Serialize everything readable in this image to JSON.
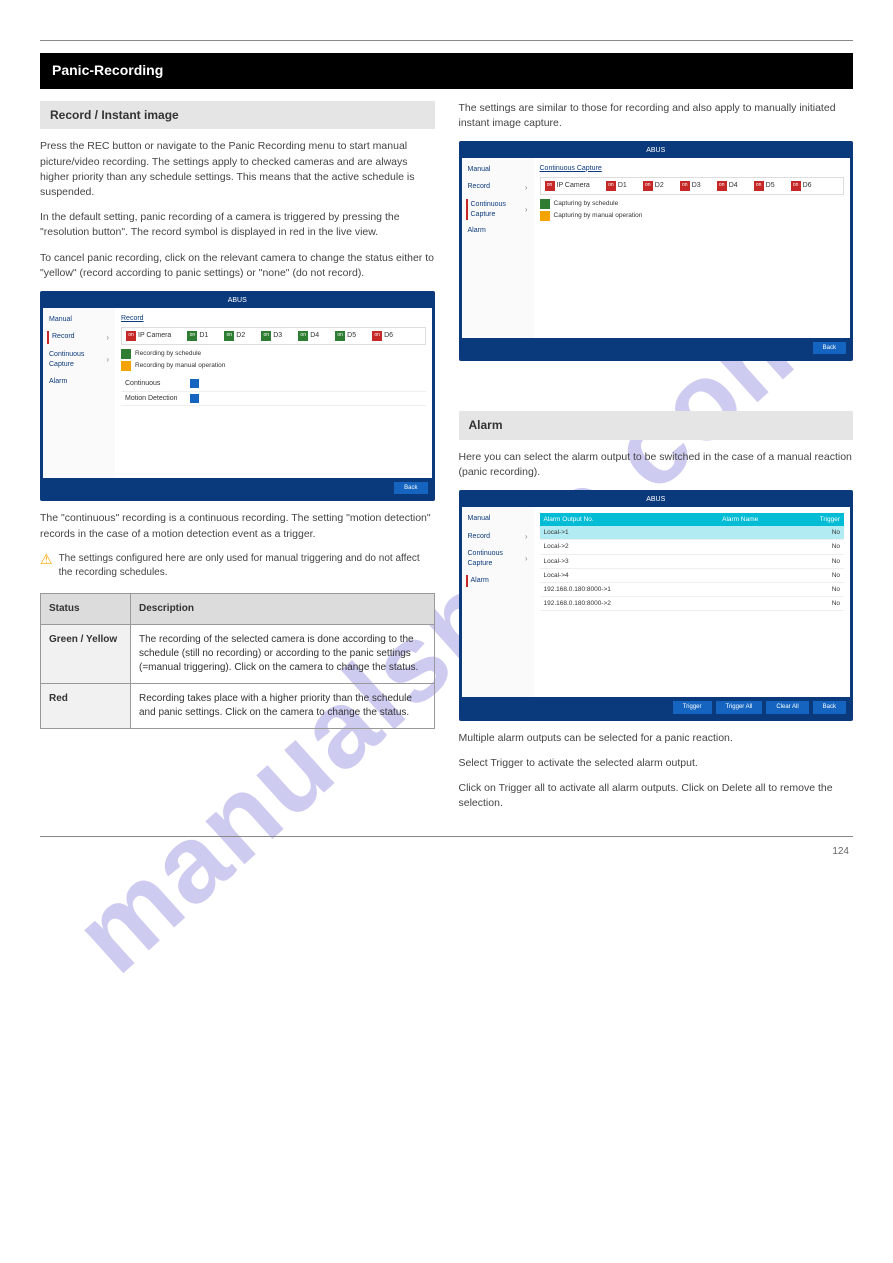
{
  "watermark": "manualshive.com",
  "page_number": "124",
  "black_bar_title": "Panic-Recording",
  "left": {
    "section_title": "Record / Instant image",
    "p1": "Press the REC button or navigate to the Panic Recording menu to start manual picture/video recording. The settings apply to checked cameras and are always higher priority than any schedule settings. This means that the active schedule is suspended.",
    "p2": "In the default setting, panic recording of a camera is triggered by pressing the \"resolution button\". The record symbol is displayed in red in the live view.",
    "p3": "To cancel panic recording, click on the relevant camera to change the status either to \"yellow\" (record according to panic settings) or \"none\" (do not record).",
    "p4": "The \"continuous\" recording is a continuous recording. The setting \"motion detection\" records in the case of a motion detection event as a trigger.",
    "warning": "The settings configured here are only used for manual triggering and do not affect the recording schedules.",
    "opt_table": {
      "h1": "Status",
      "h2": "Description",
      "rows": [
        {
          "label": "Green / Yellow",
          "desc": "The recording of the selected camera is done according to the schedule (still no recording) or according to the panic settings (=manual triggering). Click on the camera to change the status."
        },
        {
          "label": "Red",
          "desc": "Recording takes place with a higher priority than the schedule and panic settings. Click on the camera to change the status."
        }
      ]
    },
    "screenshot": {
      "logo": "ABUS",
      "sidebar": [
        "Manual",
        "Record",
        "Continuous Capture",
        "Alarm"
      ],
      "active": "Record",
      "main_title": "Record",
      "cam_header": "IP Camera",
      "cameras": [
        {
          "label": "D1",
          "state": "green"
        },
        {
          "label": "D2",
          "state": "green"
        },
        {
          "label": "D3",
          "state": "green"
        },
        {
          "label": "D4",
          "state": "green"
        },
        {
          "label": "D5",
          "state": "green"
        },
        {
          "label": "D6",
          "state": "red"
        }
      ],
      "legend": [
        {
          "color": "green",
          "text": "Recording by schedule"
        },
        {
          "color": "yellow",
          "text": "Recording by manual operation"
        }
      ],
      "rows": [
        {
          "label": "Continuous",
          "checked": true
        },
        {
          "label": "Motion Detection",
          "checked": true
        }
      ],
      "back_btn": "Back"
    }
  },
  "right": {
    "cc_p1": "The settings are similar to those for recording and also apply to manually initiated instant image capture.",
    "cc_screenshot": {
      "logo": "ABUS",
      "sidebar": [
        "Manual",
        "Record",
        "Continuous Capture",
        "Alarm"
      ],
      "active": "Continuous Capture",
      "main_title": "Continuous Capture",
      "cam_header": "IP Camera",
      "cameras": [
        {
          "label": "D1",
          "state": "red"
        },
        {
          "label": "D2",
          "state": "red"
        },
        {
          "label": "D3",
          "state": "red"
        },
        {
          "label": "D4",
          "state": "red"
        },
        {
          "label": "D5",
          "state": "red"
        },
        {
          "label": "D6",
          "state": "red"
        }
      ],
      "legend": [
        {
          "color": "green",
          "text": "Capturing by schedule"
        },
        {
          "color": "yellow",
          "text": "Capturing by manual operation"
        }
      ],
      "back_btn": "Back"
    },
    "alarm_title": "Alarm",
    "alarm_p1": "Here you can select the alarm output to be switched in the case of a manual reaction (panic recording).",
    "alarm_p2": "Multiple alarm outputs can be selected for a panic reaction.",
    "alarm_p3": "Select Trigger to activate the selected alarm output.",
    "alarm_p4": "Click on Trigger all to activate all alarm outputs. Click on Delete all to remove the selection.",
    "alarm_screenshot": {
      "logo": "ABUS",
      "sidebar": [
        "Manual",
        "Record",
        "Continuous Capture",
        "Alarm"
      ],
      "active": "Alarm",
      "table": {
        "headers": [
          "Alarm Output No.",
          "Alarm Name",
          "Trigger"
        ],
        "rows": [
          {
            "no": "Local->1",
            "name": "",
            "trigger": "No",
            "hl": true
          },
          {
            "no": "Local->2",
            "name": "",
            "trigger": "No"
          },
          {
            "no": "Local->3",
            "name": "",
            "trigger": "No"
          },
          {
            "no": "Local->4",
            "name": "",
            "trigger": "No"
          },
          {
            "no": "192.168.0.180:8000->1",
            "name": "",
            "trigger": "No"
          },
          {
            "no": "192.168.0.180:8000->2",
            "name": "",
            "trigger": "No"
          }
        ]
      },
      "buttons": [
        "Trigger",
        "Trigger All",
        "Clear All",
        "Back"
      ]
    }
  }
}
